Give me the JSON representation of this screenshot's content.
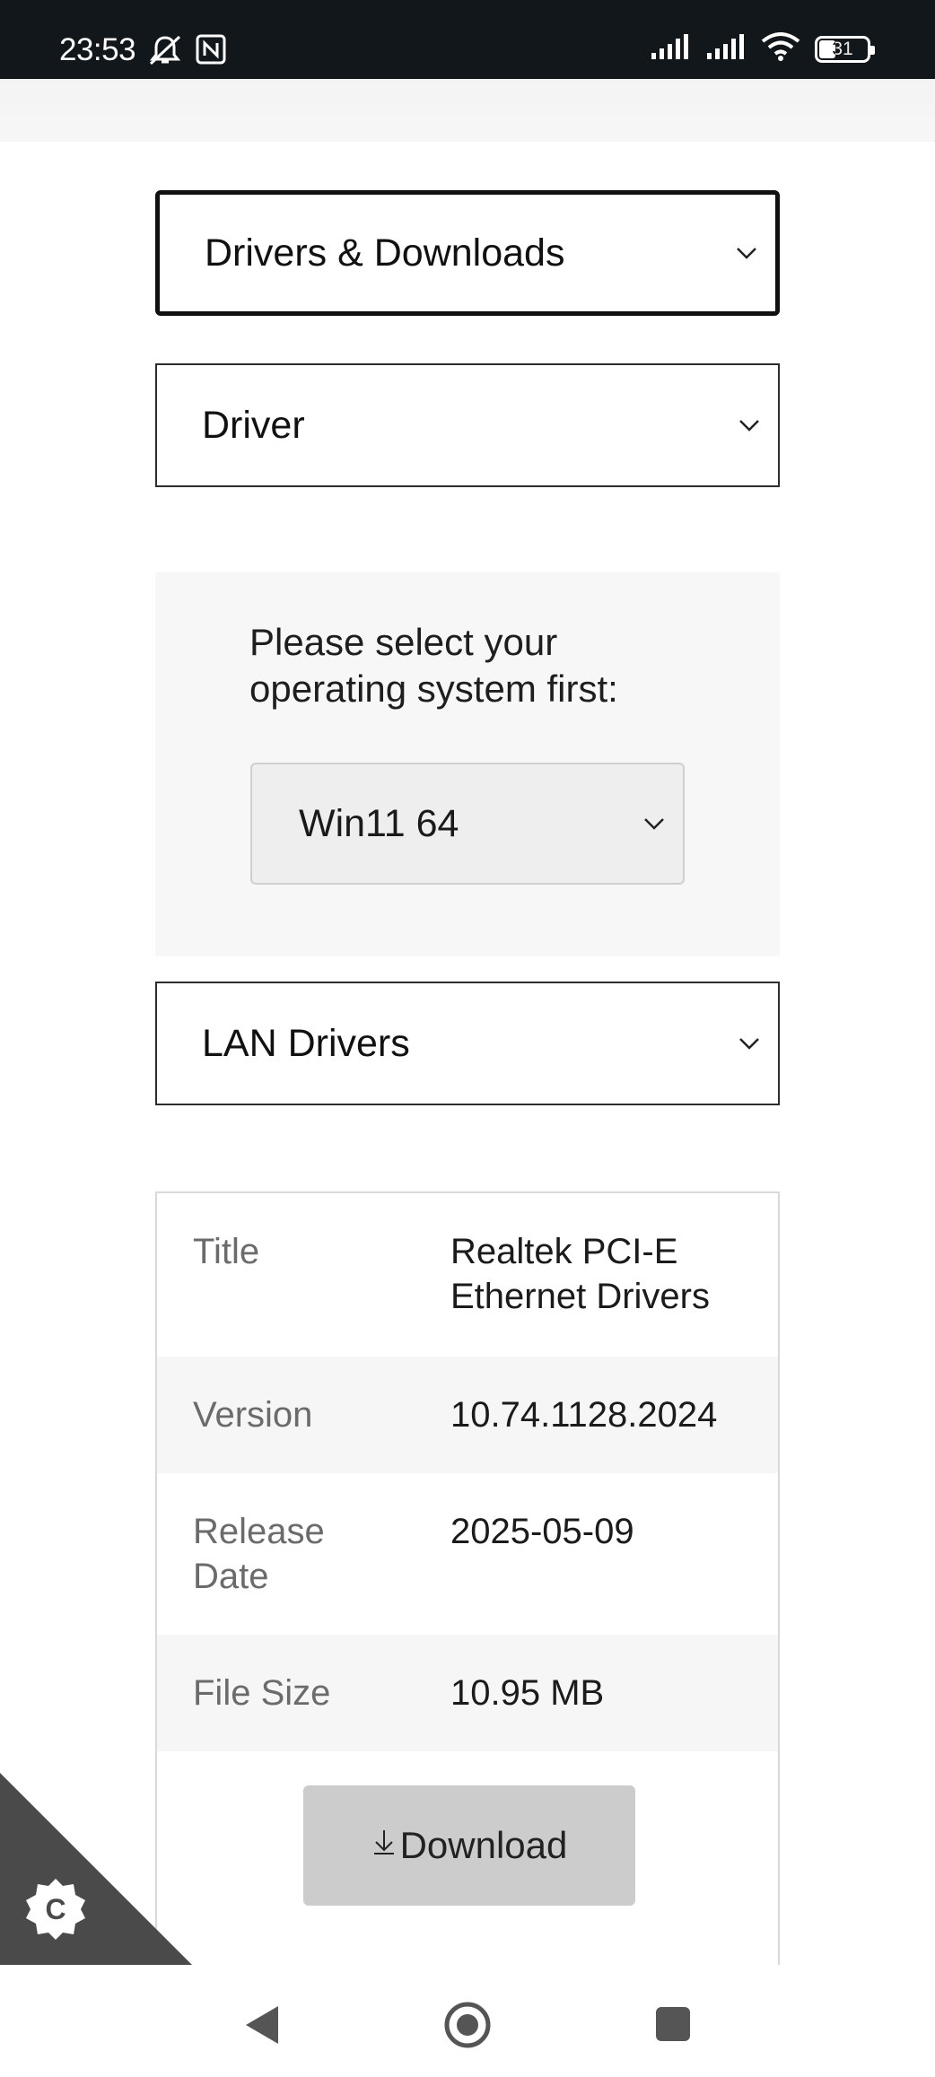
{
  "status_bar": {
    "time": "23:53",
    "battery": "31",
    "icons": [
      "mute-icon",
      "nfc-icon",
      "signal-icon",
      "signal-icon",
      "wifi-icon",
      "battery-icon"
    ]
  },
  "filters": {
    "category": "Drivers & Downloads",
    "type": "Driver",
    "os_prompt": "Please select your operating system first:",
    "os_value": "Win11 64",
    "driver_group": "LAN Drivers"
  },
  "details": {
    "rows": [
      {
        "key": "Title",
        "value": "Realtek PCI-E Ethernet Drivers"
      },
      {
        "key": "Version",
        "value": "10.74.1128.2024"
      },
      {
        "key": "Release Date",
        "value": "2025-05-09"
      },
      {
        "key": "File Size",
        "value": "10.95 MB"
      }
    ],
    "download_label": "Download",
    "download_icon": "download-arrow-icon"
  },
  "cookie_badge": {
    "letter": "C",
    "icon": "cookie-settings-icon"
  },
  "nav": {
    "icons": [
      "back-icon",
      "home-icon",
      "recents-icon"
    ]
  },
  "colors": {
    "status_bar_bg": "#12171b",
    "download_btn_bg": "#cccccc",
    "cookie_corner_bg": "#4a4a4a"
  }
}
